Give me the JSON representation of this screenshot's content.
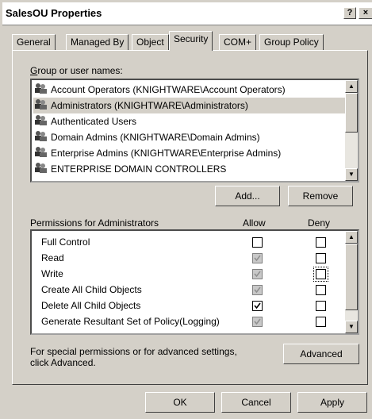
{
  "window": {
    "title": "SalesOU Properties",
    "help_btn": "?",
    "close_btn": "×"
  },
  "tabs": [
    "General",
    "Managed By",
    "Object",
    "Security",
    "COM+",
    "Group Policy"
  ],
  "active_tab": "Security",
  "groups": {
    "label": "Group or user names:",
    "items": [
      "Account Operators (KNIGHTWARE\\Account Operators)",
      "Administrators (KNIGHTWARE\\Administrators)",
      "Authenticated Users",
      "Domain Admins (KNIGHTWARE\\Domain Admins)",
      "Enterprise Admins (KNIGHTWARE\\Enterprise Admins)",
      "ENTERPRISE DOMAIN CONTROLLERS"
    ],
    "selected": "Administrators (KNIGHTWARE\\Administrators)"
  },
  "buttons": {
    "add": "Add...",
    "remove": "Remove",
    "advanced": "Advanced",
    "ok": "OK",
    "cancel": "Cancel",
    "apply": "Apply"
  },
  "permissions": {
    "label": "Permissions for Administrators",
    "allow_header": "Allow",
    "deny_header": "Deny",
    "rows": [
      {
        "name": "Full Control",
        "allow": "unchecked",
        "deny": "unchecked"
      },
      {
        "name": "Read",
        "allow": "inherited",
        "deny": "unchecked"
      },
      {
        "name": "Write",
        "allow": "inherited",
        "deny": "unchecked"
      },
      {
        "name": "Create All Child Objects",
        "allow": "inherited",
        "deny": "unchecked"
      },
      {
        "name": "Delete All Child Objects",
        "allow": "checked",
        "deny": "unchecked"
      },
      {
        "name": "Generate Resultant Set of Policy(Logging)",
        "allow": "inherited",
        "deny": "unchecked"
      }
    ]
  },
  "special": {
    "line1": "For special permissions or for advanced settings,",
    "line2": "click Advanced."
  }
}
